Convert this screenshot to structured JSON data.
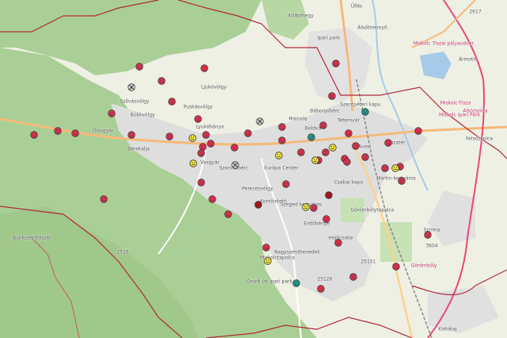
{
  "map": {
    "labels": [
      {
        "text": "Kilátóhegy",
        "color": "gray"
      },
      {
        "text": "Üllés",
        "color": "gray"
      },
      {
        "text": "Álsóbrennyő",
        "color": "gray"
      },
      {
        "text": "Ipari park",
        "color": "gray"
      },
      {
        "text": "Ármotó",
        "color": "gray"
      },
      {
        "text": "Szilvásvölgy",
        "color": "gray"
      },
      {
        "text": "Puskásvölgy",
        "color": "gray"
      },
      {
        "text": "Ljukóvölgy",
        "color": "gray"
      },
      {
        "text": "Bábonyibérc",
        "color": "gray"
      },
      {
        "text": "Szentpéteri kapu",
        "color": "gray"
      },
      {
        "text": "Mainola",
        "color": "gray"
      },
      {
        "text": "Boldva",
        "color": "gray"
      },
      {
        "text": "Tetemvár",
        "color": "gray"
      },
      {
        "text": "Avasi",
        "color": "gray"
      },
      {
        "text": "Búzatér",
        "color": "gray"
      },
      {
        "text": "Felsőzsolca",
        "color": "gray"
      },
      {
        "text": "Diósgyőr",
        "color": "gray"
      },
      {
        "text": "Bükkvölgy",
        "color": "gray"
      },
      {
        "text": "Vasgyár",
        "color": "gray"
      },
      {
        "text": "Európa Center",
        "color": "gray"
      },
      {
        "text": "Perecesvölgy",
        "color": "gray"
      },
      {
        "text": "Bérekalja",
        "color": "gray"
      },
      {
        "text": "Martin-kertváros",
        "color": "gray"
      },
      {
        "text": "Csabai kapu",
        "color": "gray"
      },
      {
        "text": "Szirma",
        "color": "gray"
      },
      {
        "text": "Szarvasbérc",
        "color": "gray"
      },
      {
        "text": "Komlóstető",
        "color": "gray"
      },
      {
        "text": "Görömbölytapolca",
        "color": "gray"
      },
      {
        "text": "Szeged kertváros",
        "color": "gray"
      },
      {
        "text": "Bükkszentlászló",
        "color": "gray"
      },
      {
        "text": "Erdőbénye",
        "color": "gray"
      },
      {
        "text": "Nagyszentbenedek",
        "color": "gray"
      },
      {
        "text": "Hejőcsaba",
        "color": "gray"
      },
      {
        "text": "Lyukóbánya",
        "color": "gray"
      },
      {
        "text": "Miskolctapolca",
        "color": "gray"
      },
      {
        "text": "Kistokaj",
        "color": "gray"
      },
      {
        "text": "Ónodi úti ipari park",
        "color": "gray"
      },
      {
        "text": "Miskolc Tiszai pályaudvar",
        "color": "red"
      },
      {
        "text": "Miskolc-Tisza",
        "color": "red"
      },
      {
        "text": "Alsózsolca",
        "color": "red"
      },
      {
        "text": "Miskolc Ipari Park",
        "color": "red"
      },
      {
        "text": "Görömböly",
        "color": "red"
      },
      {
        "text": "2617",
        "color": "gray"
      },
      {
        "text": "3604",
        "color": "gray"
      },
      {
        "text": "25151",
        "color": "gray"
      },
      {
        "text": "2519",
        "color": "gray"
      },
      {
        "text": "25126",
        "color": "gray"
      }
    ],
    "markers": [
      {
        "status": "red"
      },
      {
        "status": "red"
      },
      {
        "status": "red"
      },
      {
        "status": "red"
      },
      {
        "status": "red"
      },
      {
        "status": "red"
      },
      {
        "status": "red"
      },
      {
        "status": "red"
      },
      {
        "status": "red"
      },
      {
        "status": "red"
      },
      {
        "status": "red"
      },
      {
        "status": "red"
      },
      {
        "status": "red"
      },
      {
        "status": "red"
      },
      {
        "status": "red"
      },
      {
        "status": "red"
      },
      {
        "status": "red"
      },
      {
        "status": "red"
      },
      {
        "status": "red"
      },
      {
        "status": "red"
      },
      {
        "status": "red"
      },
      {
        "status": "red"
      },
      {
        "status": "red"
      },
      {
        "status": "red"
      },
      {
        "status": "red"
      },
      {
        "status": "red"
      },
      {
        "status": "red"
      },
      {
        "status": "red"
      },
      {
        "status": "red"
      },
      {
        "status": "red"
      },
      {
        "status": "red"
      },
      {
        "status": "red"
      },
      {
        "status": "red"
      },
      {
        "status": "red"
      },
      {
        "status": "red"
      },
      {
        "status": "red"
      },
      {
        "status": "red"
      },
      {
        "status": "red"
      },
      {
        "status": "red"
      },
      {
        "status": "red"
      },
      {
        "status": "red"
      },
      {
        "status": "red"
      },
      {
        "status": "red"
      },
      {
        "status": "red"
      },
      {
        "status": "red"
      },
      {
        "status": "red"
      },
      {
        "status": "red"
      },
      {
        "status": "red"
      },
      {
        "status": "yellow"
      },
      {
        "status": "yellow"
      },
      {
        "status": "yellow"
      },
      {
        "status": "yellow"
      },
      {
        "status": "yellow"
      },
      {
        "status": "yellow"
      },
      {
        "status": "yellow"
      },
      {
        "status": "yellow"
      },
      {
        "status": "teal"
      },
      {
        "status": "teal"
      },
      {
        "status": "teal"
      },
      {
        "status": "darkred"
      },
      {
        "status": "darkred"
      },
      {
        "status": "offline"
      },
      {
        "status": "offline"
      },
      {
        "status": "offline"
      }
    ],
    "colors": {
      "red": "#e8304f",
      "yellow": "#f2e63a",
      "teal": "#1f9f92",
      "darkred": "#b0141c",
      "offline": "#d8d8d8",
      "forest": "#a9cf96",
      "urban": "#dcdcdc",
      "boundary": "#b02a3a",
      "road_major": "#f6b97a",
      "rail": "#888888"
    }
  }
}
